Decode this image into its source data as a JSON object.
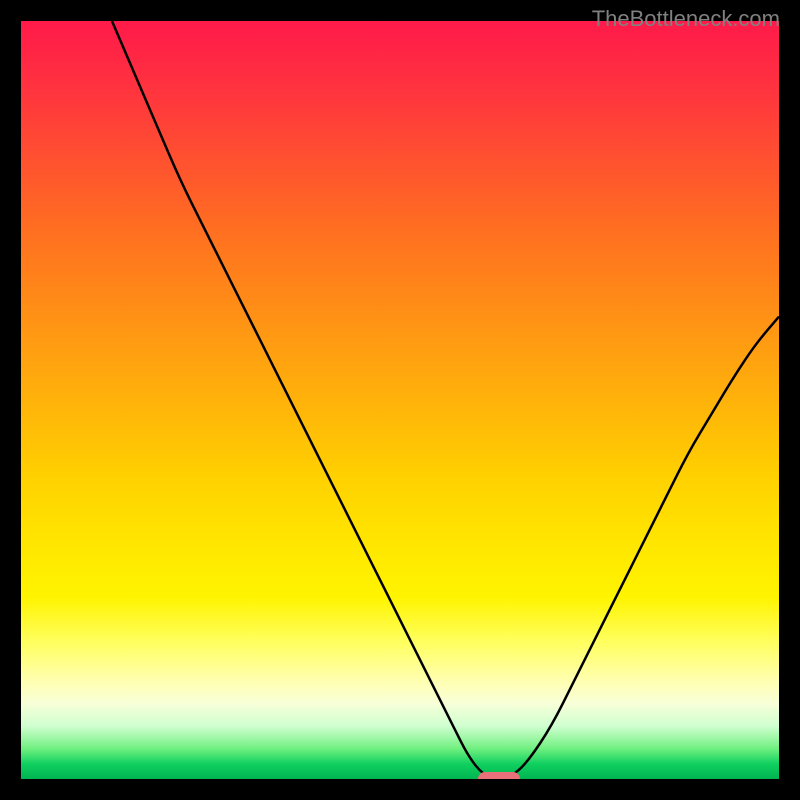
{
  "watermark": "TheBottleneck.com",
  "colors": {
    "background": "#000000",
    "curve": "#000000",
    "marker": "#e8707a",
    "watermark_text": "#808080"
  },
  "chart_data": {
    "type": "line",
    "title": "",
    "xlabel": "",
    "ylabel": "",
    "xlim": [
      0,
      100
    ],
    "ylim": [
      0,
      100
    ],
    "curve_points": [
      {
        "x": 12,
        "y": 100
      },
      {
        "x": 15,
        "y": 93
      },
      {
        "x": 18,
        "y": 86
      },
      {
        "x": 21,
        "y": 79
      },
      {
        "x": 24,
        "y": 73
      },
      {
        "x": 27,
        "y": 67
      },
      {
        "x": 30,
        "y": 61
      },
      {
        "x": 33,
        "y": 55
      },
      {
        "x": 36,
        "y": 49
      },
      {
        "x": 39,
        "y": 43
      },
      {
        "x": 42,
        "y": 37
      },
      {
        "x": 45,
        "y": 31
      },
      {
        "x": 48,
        "y": 25
      },
      {
        "x": 51,
        "y": 19
      },
      {
        "x": 54,
        "y": 13
      },
      {
        "x": 57,
        "y": 7
      },
      {
        "x": 59,
        "y": 3
      },
      {
        "x": 61,
        "y": 0.5
      },
      {
        "x": 63,
        "y": 0
      },
      {
        "x": 65,
        "y": 0.5
      },
      {
        "x": 67,
        "y": 2.5
      },
      {
        "x": 70,
        "y": 7
      },
      {
        "x": 73,
        "y": 13
      },
      {
        "x": 76,
        "y": 19
      },
      {
        "x": 79,
        "y": 25
      },
      {
        "x": 82,
        "y": 31
      },
      {
        "x": 85,
        "y": 37
      },
      {
        "x": 88,
        "y": 43
      },
      {
        "x": 91,
        "y": 48
      },
      {
        "x": 94,
        "y": 53
      },
      {
        "x": 97,
        "y": 57.5
      },
      {
        "x": 100,
        "y": 61
      }
    ],
    "marker": {
      "x": 63,
      "y": 0
    },
    "gradient_stops": [
      {
        "pos": 0,
        "color": "#ff1a4a"
      },
      {
        "pos": 50,
        "color": "#ffc400"
      },
      {
        "pos": 85,
        "color": "#ffff80"
      },
      {
        "pos": 100,
        "color": "#00b450"
      }
    ]
  }
}
